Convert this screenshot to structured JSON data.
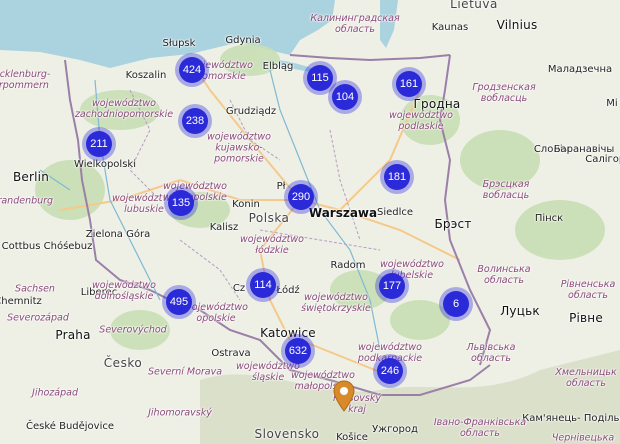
{
  "map": {
    "colors": {
      "land": "#eef0e6",
      "sea": "#aad3df",
      "forest": "#c8dfb4",
      "mountain": "#d6dcc4",
      "border": "#9b7fa8",
      "road": "#f6c98a",
      "cluster": "#2a2ad8",
      "pin": "#d88a2a"
    },
    "clusters": [
      {
        "count": "424"
      },
      {
        "count": "115"
      },
      {
        "count": "104"
      },
      {
        "count": "161"
      },
      {
        "count": "238"
      },
      {
        "count": "211"
      },
      {
        "count": "181"
      },
      {
        "count": "135"
      },
      {
        "count": "290"
      },
      {
        "count": "114"
      },
      {
        "count": "177"
      },
      {
        "count": "495"
      },
      {
        "count": "6"
      },
      {
        "count": "632"
      },
      {
        "count": "246"
      }
    ],
    "marker": {
      "icon": "map-pin-icon"
    },
    "labels": {
      "lietuva": "Lietuva",
      "kaliningrad": "Калининградская\nобласть",
      "kaunas": "Kaunas",
      "vilnius": "Vilnius",
      "maladzyechna": "Маладзечна",
      "grodno": "Гродна",
      "grodno_obl": "Гродзенская\nвобласць",
      "minsk": "Мі",
      "slonim": "Слонім",
      "baranavichy": "Баранавічы",
      "salihorsk": "Салігорс",
      "brest_obl": "Брэсцкая\nвобласць",
      "pinsk": "Пінск",
      "brest": "Брэст",
      "volyn": "Волинська\nобласть",
      "lutsk": "Луцьк",
      "rivne_obl": "Рівненська\nобласть",
      "rivne": "Рівне",
      "lviv_obl": "Львівська\nобласть",
      "khmelnytsk": "Хмельницьк\nобласть",
      "kamianets": "Кам'янець-\nПодільський",
      "ivano": "Івано-Франківська\nобласть",
      "chernivtsi": "Чернівецька",
      "uzhhorod": "Ужгород",
      "kosice": "Košice",
      "slovensko": "Slovensko",
      "presov": "Prešovský\nkraj",
      "ostrava": "Ostrava",
      "cesko": "Česko",
      "severni_morava": "Severní Morava",
      "jihomoravsky": "Jihomoravský",
      "jihozapad": "Jihozápad",
      "ceske_budejovice": "České\nBudějovice",
      "praha": "Praha",
      "severovychod": "Severovýchod",
      "severozapad": "Severozápad",
      "liberec": "Liberec",
      "chemnitz": "Chemnitz",
      "sachsen": "Sachsen",
      "cottbus": "Cottbus\nChóśebuz",
      "berlin": "Berlin",
      "brandenburg": "Brandenburg",
      "mvp": "Mecklenburg-\nVorpommern",
      "koszalin": "Koszalin",
      "slupsk": "Słupsk",
      "gdynia": "Gdynia",
      "elblag": "Elbląg",
      "grudziadz": "Grudziądz",
      "wielkopolski": "Wielkopolski",
      "zielona_gora": "Zielona\nGóra",
      "konin": "Konin",
      "kalisz": "Kalisz",
      "polska": "Polska",
      "warszawa": "Warszawa",
      "siedlce": "Siedlce",
      "radom": "Radom",
      "katowice": "Katowice",
      "lodz": "Łódź",
      "pl": "Pł",
      "cz": "Cz",
      "zachodniopomorskie": "województwo\nzachodniopomorskie",
      "pomorskie": "województwo\npomorskie",
      "kujawsko": "województwo\nkujawsko-\npomorskie",
      "podlaskie": "województwo\npodlaskie",
      "lubuskie": "województwo\nlubuskie",
      "wielkopolskie": "województwo\nwielkopolskie",
      "lodzkie": "województwo\nłódzkie",
      "lubelskie": "województwo\nlubelskie",
      "swietokrzyskie": "województwo\nświętokrzyskie",
      "dolnoslaskie": "województwo\ndolnośląskie",
      "opolskie": "województwo\nopolskie",
      "malopolskie": "województwo\nmałopolskie",
      "podkarpackie": "województwo\npodkarpackie",
      "slaskie": "województwo\nśląskie"
    }
  }
}
